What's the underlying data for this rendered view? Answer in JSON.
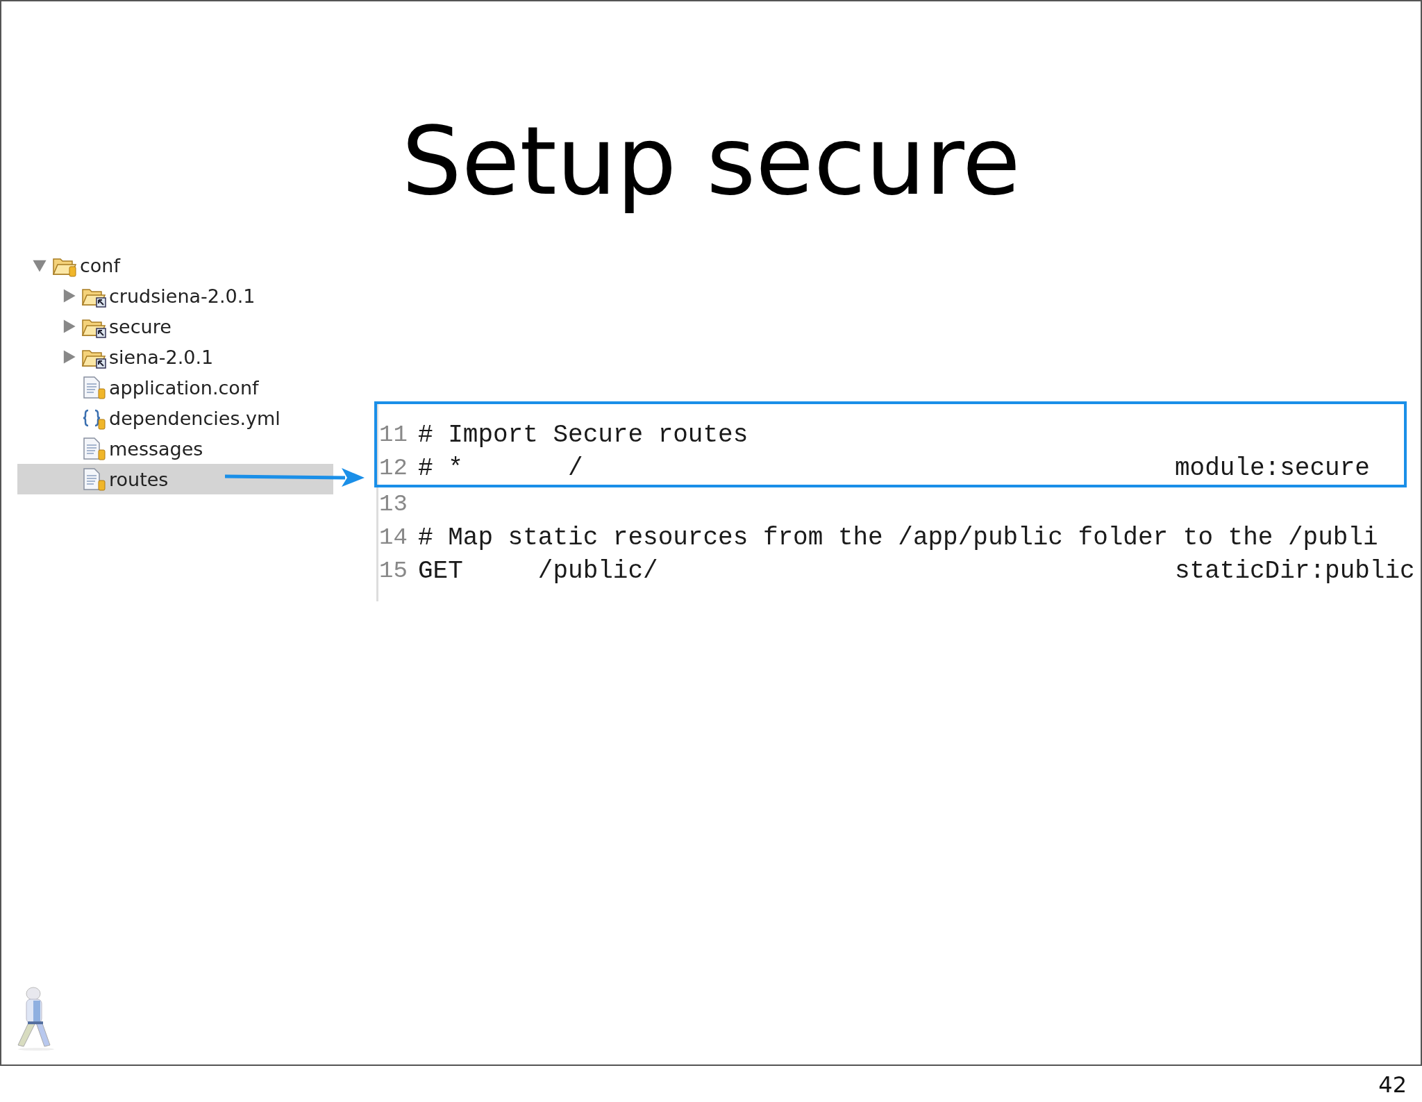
{
  "slide": {
    "title": "Setup secure",
    "page_number": "42"
  },
  "tree": [
    {
      "label": "conf",
      "kind": "folder",
      "expanded": true,
      "selected": false,
      "children": [
        {
          "label": "crudsiena-2.0.1",
          "kind": "linked-folder",
          "expanded": false,
          "selected": false
        },
        {
          "label": "secure",
          "kind": "linked-folder",
          "expanded": false,
          "selected": false
        },
        {
          "label": "siena-2.0.1",
          "kind": "linked-folder",
          "expanded": false,
          "selected": false
        },
        {
          "label": "application.conf",
          "kind": "file",
          "selected": false
        },
        {
          "label": "dependencies.yml",
          "kind": "yaml",
          "selected": false
        },
        {
          "label": "messages",
          "kind": "file",
          "selected": false
        },
        {
          "label": "routes",
          "kind": "file",
          "selected": true
        }
      ]
    }
  ],
  "editor": {
    "lines": [
      {
        "number": "11",
        "code": "# Import Secure routes",
        "highlighted": true
      },
      {
        "number": "12",
        "code": "# *       /",
        "right": "module:secure",
        "highlighted": true
      },
      {
        "number": "13",
        "highlighted": false
      },
      {
        "number": "14",
        "code": "# Map static resources from the /app/public folder to the /publi",
        "highlighted": false
      },
      {
        "number": "15",
        "code": "GET     /public/",
        "right": "staticDir:public",
        "highlighted": false
      }
    ]
  }
}
